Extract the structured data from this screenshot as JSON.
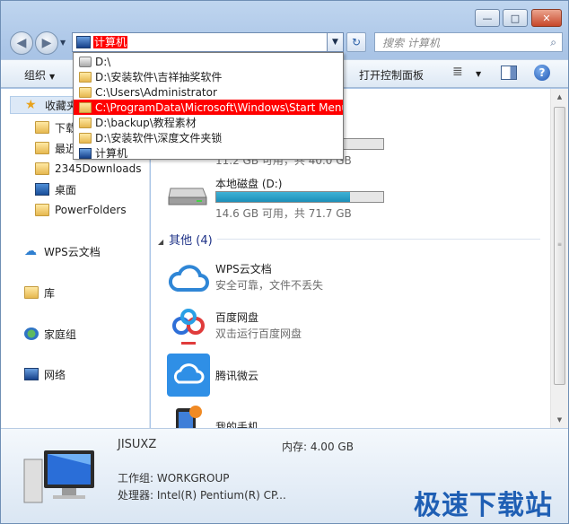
{
  "window": {
    "min": "—",
    "max": "□",
    "close": "✕"
  },
  "nav": {
    "back": "◀",
    "forward": "▶",
    "history": "▼"
  },
  "address": {
    "value": "计算机",
    "drop": "▼",
    "refresh": "↻"
  },
  "search": {
    "placeholder": "搜索 计算机"
  },
  "toolbar": {
    "organize": "组织",
    "organize_arrow": "▼",
    "control_panel": "打开控制面板",
    "view_icon": "≣",
    "view_arrow": "▼",
    "help": "?"
  },
  "dropdown": [
    {
      "label": "D:\\",
      "icon": "drive"
    },
    {
      "label": "D:\\安装软件\\吉祥抽奖软件",
      "icon": "folder"
    },
    {
      "label": "C:\\Users\\Administrator",
      "icon": "folder"
    },
    {
      "label": "C:\\ProgramData\\Microsoft\\Windows\\Start Menu",
      "icon": "folder",
      "selected": true
    },
    {
      "label": "D:\\backup\\教程素材",
      "icon": "folder"
    },
    {
      "label": "D:\\安装软件\\深度文件夹锁",
      "icon": "folder"
    },
    {
      "label": "计算机",
      "icon": "computer"
    }
  ],
  "sidebar": {
    "favorites": "收藏夹",
    "items": [
      "下载",
      "最近访问的位置",
      "2345Downloads",
      "桌面",
      "PowerFolders"
    ],
    "wps": "WPS云文档",
    "library": "库",
    "homegroup": "家庭组",
    "network": "网络"
  },
  "drives": [
    {
      "name": "",
      "info": "11.2 GB 可用，共 40.0 GB",
      "used": 0.72
    },
    {
      "name": "本地磁盘 (D:)",
      "info": "14.6 GB 可用，共 71.7 GB",
      "used": 0.8
    }
  ],
  "other_group": {
    "label": "其他 (4)",
    "arrow": "◢"
  },
  "apps": [
    {
      "name": "WPS云文档",
      "desc": "安全可靠，文件不丢失"
    },
    {
      "name": "百度网盘",
      "desc": "双击运行百度网盘"
    },
    {
      "name": "腾讯微云",
      "desc": ""
    },
    {
      "name": "我的手机",
      "desc": ""
    }
  ],
  "details": {
    "computer_name": "JISUXZ",
    "memory": "内存: 4.00 GB",
    "workgroup": "工作组: WORKGROUP",
    "processor": "处理器: Intel(R) Pentium(R) CP..."
  },
  "watermark": "极速下载站",
  "colors": {
    "selection": "#ff0000",
    "drive_fill": "#26a0c8"
  }
}
